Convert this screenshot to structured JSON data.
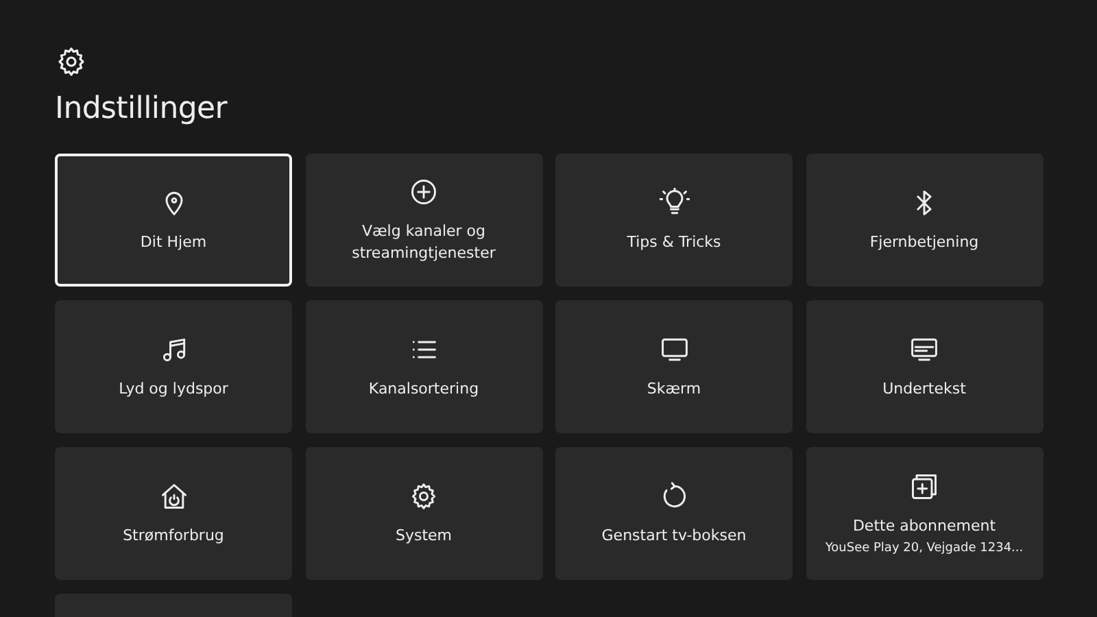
{
  "header": {
    "title": "Indstillinger"
  },
  "tiles": [
    {
      "label": "Dit Hjem",
      "selected": true
    },
    {
      "label": "Vælg kanaler og streamingtjenester",
      "selected": false
    },
    {
      "label": "Tips & Tricks",
      "selected": false
    },
    {
      "label": "Fjernbetjening",
      "selected": false
    },
    {
      "label": "Lyd og lydspor",
      "selected": false
    },
    {
      "label": "Kanalsortering",
      "selected": false
    },
    {
      "label": "Skærm",
      "selected": false
    },
    {
      "label": "Undertekst",
      "selected": false
    },
    {
      "label": "Strømforbrug",
      "selected": false
    },
    {
      "label": "System",
      "selected": false
    },
    {
      "label": "Genstart tv-boksen",
      "selected": false
    },
    {
      "label": "Dette abonnement",
      "subtitle": "YouSee Play 20, Vejgade 1234...",
      "selected": false
    }
  ]
}
